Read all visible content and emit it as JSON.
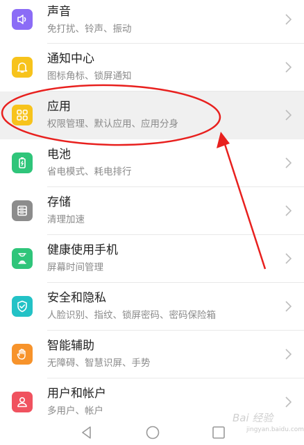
{
  "settings": {
    "items": [
      {
        "title": "声音",
        "subtitle": "免打扰、铃声、振动",
        "icon": "speaker-icon",
        "color": "#8b6cf6"
      },
      {
        "title": "通知中心",
        "subtitle": "图标角标、锁屏通知",
        "icon": "bell-icon",
        "color": "#f7c31c"
      },
      {
        "title": "应用",
        "subtitle": "权限管理、默认应用、应用分身",
        "icon": "apps-grid-icon",
        "color": "#f7c31c"
      },
      {
        "title": "电池",
        "subtitle": "省电模式、耗电排行",
        "icon": "battery-icon",
        "color": "#2fc57a"
      },
      {
        "title": "存储",
        "subtitle": "清理加速",
        "icon": "storage-icon",
        "color": "#8c8c8c"
      },
      {
        "title": "健康使用手机",
        "subtitle": "屏幕时间管理",
        "icon": "hourglass-icon",
        "color": "#2fc57a"
      },
      {
        "title": "安全和隐私",
        "subtitle": "人脸识别、指纹、锁屏密码、密码保险箱",
        "icon": "shield-icon",
        "color": "#23c2c6"
      },
      {
        "title": "智能辅助",
        "subtitle": "无障碍、智慧识屏、手势",
        "icon": "hand-icon",
        "color": "#f7932b"
      },
      {
        "title": "用户和帐户",
        "subtitle": "多用户、帐户",
        "icon": "user-icon",
        "color": "#f0525f"
      }
    ]
  },
  "annotation": {
    "color": "#e8201e"
  },
  "watermark": {
    "text": "Bai 经验",
    "url": "jingyan.baidu.com"
  }
}
